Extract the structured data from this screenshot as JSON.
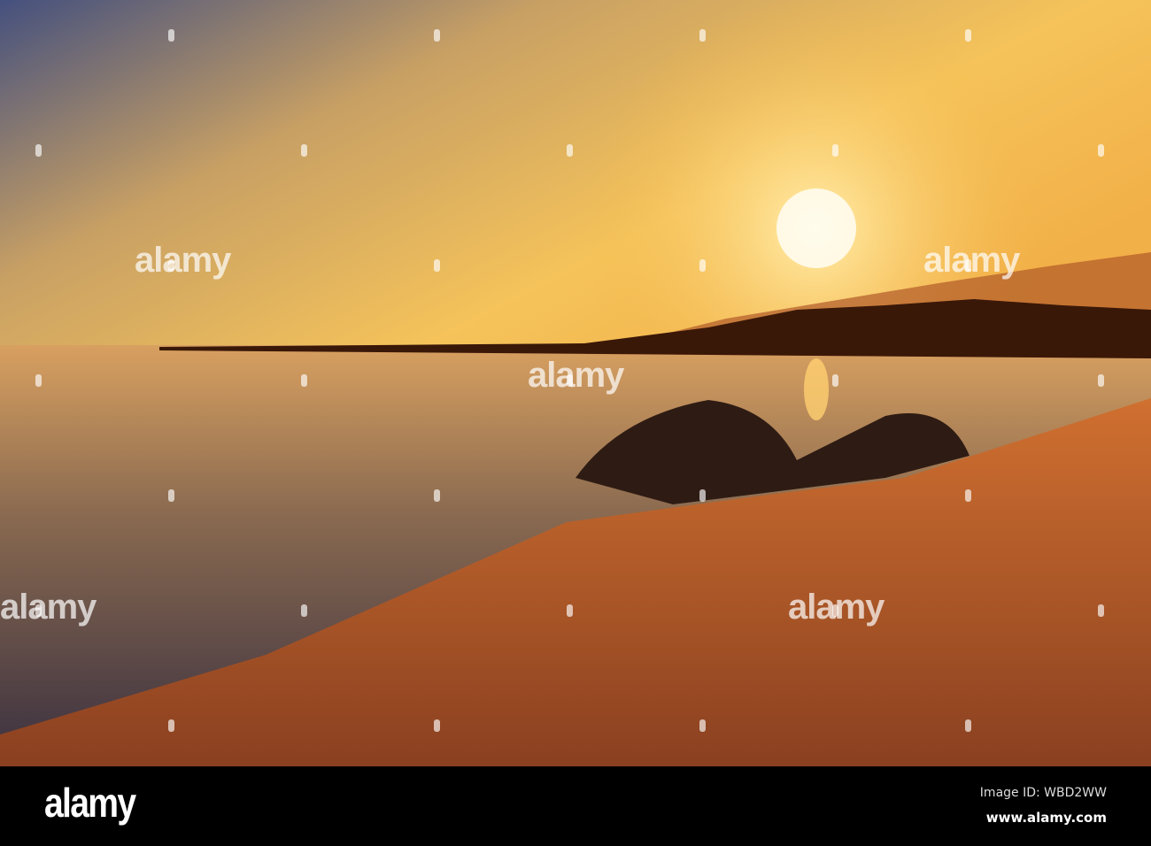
{
  "photo": {
    "description_colors": {
      "sky_top": "#4c5a86",
      "sky_glow": "#f6c75a",
      "sun": "#fff6c8",
      "water": "#6b5242",
      "sand": "#c0632e"
    }
  },
  "watermark": {
    "text": "alamy"
  },
  "footer": {
    "logo": "alamy",
    "image_id": "Image ID: WBD2WW",
    "url": "www.alamy.com"
  }
}
